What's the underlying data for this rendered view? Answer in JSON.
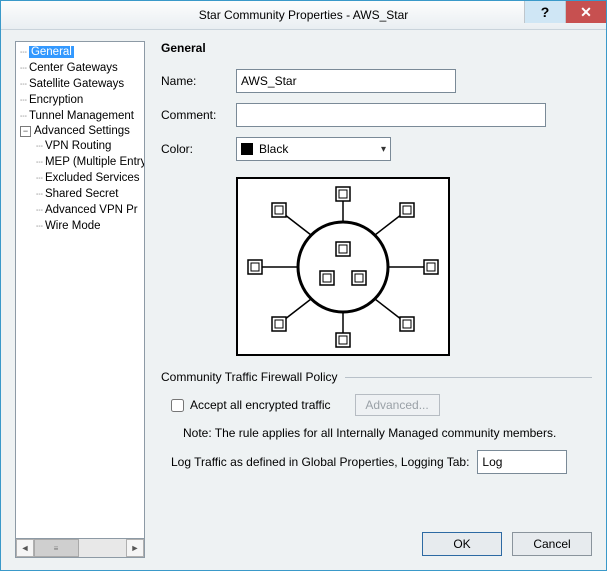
{
  "window": {
    "title": "Star Community Properties - AWS_Star"
  },
  "nav": {
    "items": [
      {
        "label": "General",
        "selected": true
      },
      {
        "label": "Center Gateways"
      },
      {
        "label": "Satellite Gateways"
      },
      {
        "label": "Encryption"
      },
      {
        "label": "Tunnel Management"
      },
      {
        "label": "Advanced Settings",
        "expandable": true,
        "expanded": true
      },
      {
        "label": "VPN Routing",
        "child": true
      },
      {
        "label": "MEP (Multiple Entry",
        "child": true
      },
      {
        "label": "Excluded Services",
        "child": true
      },
      {
        "label": "Shared Secret",
        "child": true
      },
      {
        "label": "Advanced VPN Pr",
        "child": true
      },
      {
        "label": "Wire Mode",
        "child": true
      }
    ]
  },
  "general": {
    "heading": "General",
    "name_label": "Name:",
    "name_value": "AWS_Star",
    "comment_label": "Comment:",
    "comment_value": "",
    "color_label": "Color:",
    "color_value": "Black",
    "color_hex": "#000000"
  },
  "policy": {
    "section_title": "Community Traffic Firewall Policy",
    "accept_label": "Accept all encrypted traffic",
    "accept_checked": false,
    "advanced_label": "Advanced...",
    "note": "Note: The rule applies for all Internally Managed community members.",
    "log_label": "Log Traffic as defined in Global Properties, Logging Tab:",
    "log_value": "Log"
  },
  "buttons": {
    "ok": "OK",
    "cancel": "Cancel"
  }
}
